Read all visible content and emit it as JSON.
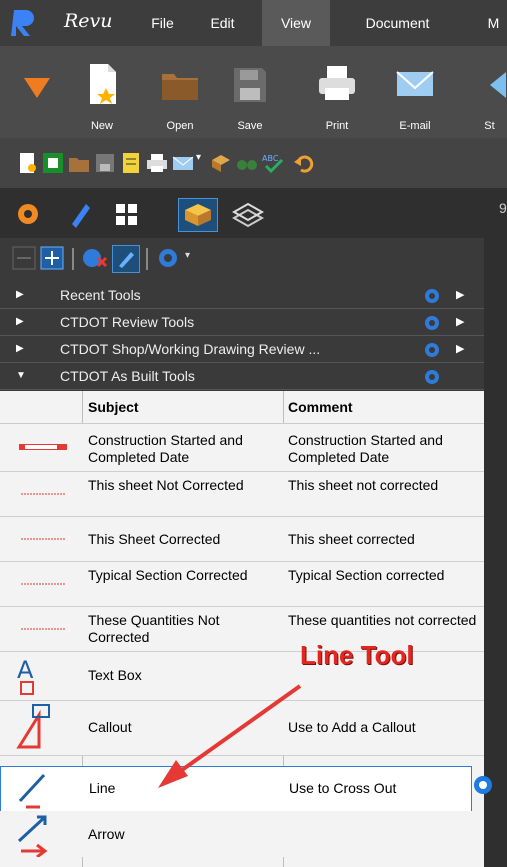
{
  "app": {
    "brand": "Revu",
    "menu": [
      {
        "label": "File"
      },
      {
        "label": "Edit"
      },
      {
        "label": "View"
      },
      {
        "label": "Document"
      },
      {
        "label": "M"
      }
    ]
  },
  "ribbon": {
    "buttons": [
      {
        "label": "New",
        "icon": "new-icon"
      },
      {
        "label": "Open",
        "icon": "open-icon"
      },
      {
        "label": "Save",
        "icon": "save-icon"
      },
      {
        "label": "Print",
        "icon": "print-icon"
      },
      {
        "label": "E-mail",
        "icon": "email-icon"
      },
      {
        "label": "St",
        "icon": "st-icon"
      }
    ]
  },
  "panel": {
    "sections": [
      {
        "label": "Recent Tools"
      },
      {
        "label": "CTDOT Review Tools"
      },
      {
        "label": "CTDOT Shop/Working Drawing Review ..."
      },
      {
        "label": "CTDOT As Built Tools"
      }
    ],
    "table": {
      "headers": {
        "subject": "Subject",
        "comment": "Comment"
      },
      "rows": [
        {
          "subject": "Construction Started and Completed Date",
          "comment": "Construction Started and Completed Date"
        },
        {
          "subject": "This sheet Not Corrected",
          "comment": "This sheet not corrected"
        },
        {
          "subject": "This Sheet Corrected",
          "comment": "This sheet corrected"
        },
        {
          "subject": "Typical Section Corrected",
          "comment": "Typical Section corrected"
        },
        {
          "subject": "These Quantities Not Corrected",
          "comment": "These quantities not corrected"
        },
        {
          "subject": "Text Box",
          "comment": ""
        },
        {
          "subject": "Callout",
          "comment": "Use to Add a Callout"
        },
        {
          "subject": "Line",
          "comment": "Use to Cross Out"
        },
        {
          "subject": "Arrow",
          "comment": ""
        }
      ]
    }
  },
  "annotation": {
    "label": "Line Tool"
  },
  "right_pane": {
    "char": "9"
  }
}
